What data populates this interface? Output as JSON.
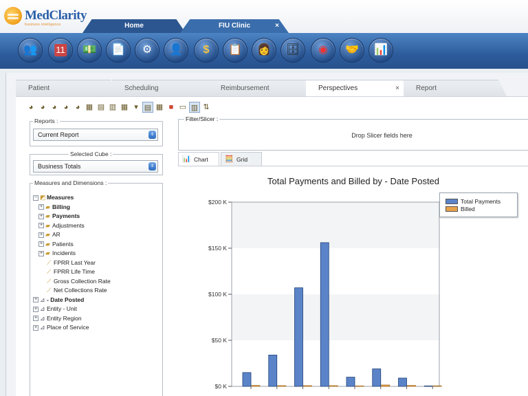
{
  "app": {
    "logo_text": "MedClarity",
    "logo_tagline": "business intelligence"
  },
  "top_tabs": [
    {
      "label": "Home"
    },
    {
      "label": "FIU Clinic",
      "close": "×"
    }
  ],
  "toolbar_icons": [
    "users-icon",
    "calendar-icon",
    "money-icon",
    "claims-icon",
    "settings-icon",
    "user-icon",
    "dollar-icon",
    "checklist-icon",
    "staff-icon",
    "cabinet-icon",
    "dashboard-icon",
    "handshake-icon",
    "bar-chart-icon"
  ],
  "sub_tabs": [
    {
      "label": "Patient"
    },
    {
      "label": "Scheduling"
    },
    {
      "label": "Reimbursement"
    },
    {
      "label": "Perspectives",
      "close": "×"
    },
    {
      "label": "Report"
    }
  ],
  "reports": {
    "legend": "Reports :",
    "value": "Current Report"
  },
  "cube": {
    "legend": "Selected Cube :",
    "value": "Business Totals"
  },
  "measures": {
    "legend": "Measures and Dimensions :",
    "tree": [
      {
        "label": "Measures",
        "bold": true
      },
      {
        "label": "Billing",
        "bold": true
      },
      {
        "label": "Payments",
        "bold": true
      },
      {
        "label": "Adjustments"
      },
      {
        "label": "AR"
      },
      {
        "label": "Patients"
      },
      {
        "label": "Incidents"
      },
      {
        "label": "FPRR Last Year"
      },
      {
        "label": "FPRR Life Time"
      },
      {
        "label": "Gross Collection Rate"
      },
      {
        "label": "Net Collections Rate"
      },
      {
        "label": "-  Date Posted",
        "bold": true
      },
      {
        "label": "Entity - Unit"
      },
      {
        "label": "Entity Region"
      },
      {
        "label": "Place of Service"
      }
    ]
  },
  "slicer": {
    "label": "Filter/Slicer :",
    "drop_text": "Drop Slicer fields here"
  },
  "chart_tabs": [
    {
      "label": "Chart"
    },
    {
      "label": "Grid"
    }
  ],
  "colors": {
    "total_payments": "#5b84c8",
    "billed": "#e8a24a",
    "header_blue": "#2d5c9c"
  },
  "chart_data": {
    "type": "bar",
    "title": "Total Payments and Billed by -  Date Posted",
    "ylim": [
      0,
      200000
    ],
    "yticks": [
      {
        "value": 0,
        "label": "$0 K"
      },
      {
        "value": 50000,
        "label": "$50 K"
      },
      {
        "value": 100000,
        "label": "$100 K"
      },
      {
        "value": 150000,
        "label": "$150 K"
      },
      {
        "value": 200000,
        "label": "$200 K"
      }
    ],
    "legend_position": "top-right",
    "series": [
      {
        "name": "Total Payments",
        "values": [
          15000,
          34000,
          107000,
          156000,
          10000,
          19000,
          9000,
          500
        ]
      },
      {
        "name": "Billed",
        "values": [
          1000,
          800,
          800,
          800,
          500,
          1500,
          1000,
          600
        ]
      }
    ]
  }
}
